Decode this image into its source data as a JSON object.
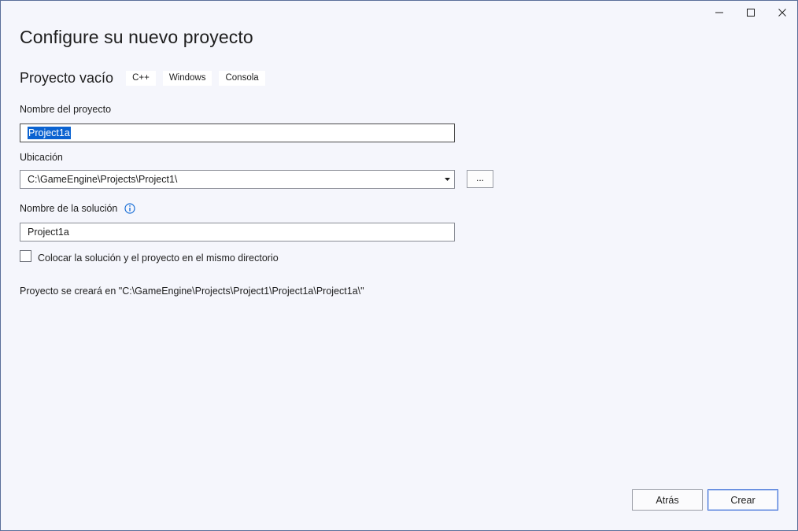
{
  "window": {
    "title": "Configure su nuevo proyecto",
    "controls": [
      "minimize-icon",
      "maximize-icon",
      "close-icon"
    ]
  },
  "template": {
    "name": "Proyecto vacío",
    "tags": [
      "C++",
      "Windows",
      "Consola"
    ]
  },
  "form": {
    "project_name_label": "Nombre del proyecto",
    "project_name_value": "Project1a",
    "location_label": "Ubicación",
    "location_value": "C:\\GameEngine\\Projects\\Project1\\",
    "browse_label": "...",
    "solution_name_label": "Nombre de la solución",
    "solution_name_value": "Project1a",
    "same_dir_checkbox_label": "Colocar la solución y el proyecto en el mismo directorio",
    "same_dir_checked": false,
    "path_note": "Proyecto se creará en \"C:\\GameEngine\\Projects\\Project1\\Project1a\\Project1a\\\""
  },
  "footer": {
    "back_label": "Atrás",
    "create_label": "Crear"
  },
  "colors": {
    "background": "#f5f6fc",
    "selection": "#0b63d1",
    "accent_border": "#3c6fd8",
    "info_icon": "#1a6fd6"
  }
}
